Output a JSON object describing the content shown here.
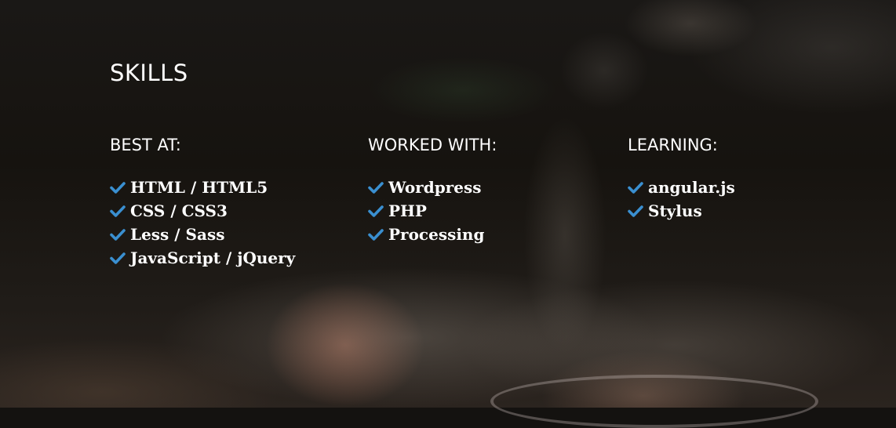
{
  "section": {
    "title": "SKILLS"
  },
  "columns": [
    {
      "heading": "BEST AT:",
      "items": [
        "HTML / HTML5",
        "CSS / CSS3",
        "Less / Sass",
        "JavaScript / jQuery"
      ]
    },
    {
      "heading": "WORKED WITH:",
      "items": [
        "Wordpress",
        "PHP",
        "Processing"
      ]
    },
    {
      "heading": "LEARNING:",
      "items": [
        "angular.js",
        "Stylus"
      ]
    }
  ],
  "icons": {
    "list_bullet": "check-icon"
  },
  "colors": {
    "accent": "#3a8fd0",
    "text": "#ffffff"
  }
}
